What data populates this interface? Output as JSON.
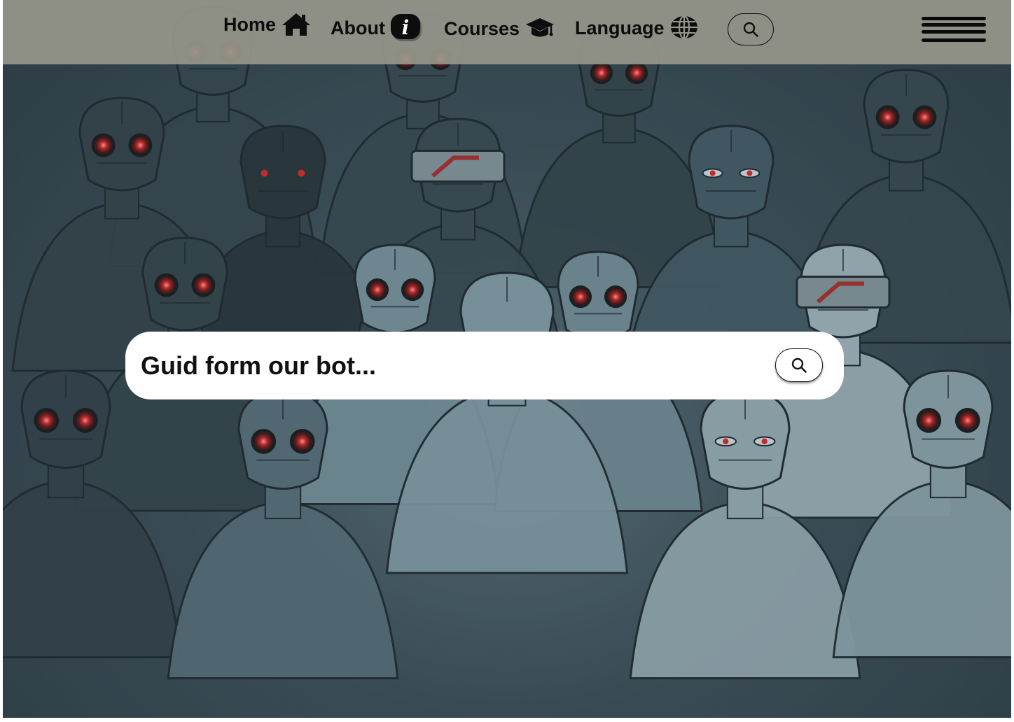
{
  "nav": {
    "home_label": "Home",
    "home_icon": "home-icon",
    "about_label": "About",
    "about_icon": "info-icon",
    "courses_label": "Courses",
    "courses_icon": "graduation-cap-icon",
    "language_label": "Language",
    "language_icon": "globe-icon",
    "search_icon": "search-icon",
    "menu_icon": "hamburger-menu-icon"
  },
  "hero": {
    "search_placeholder": "Guid form our bot...",
    "search_icon": "search-icon",
    "background": "illustration of crowd of cyborgs with glowing red eyes"
  },
  "colors": {
    "navbar_bg": "#96968a",
    "background_tone": "#3f525c",
    "eye_glow": "#e82a2a",
    "text": "#0d0d0d"
  }
}
